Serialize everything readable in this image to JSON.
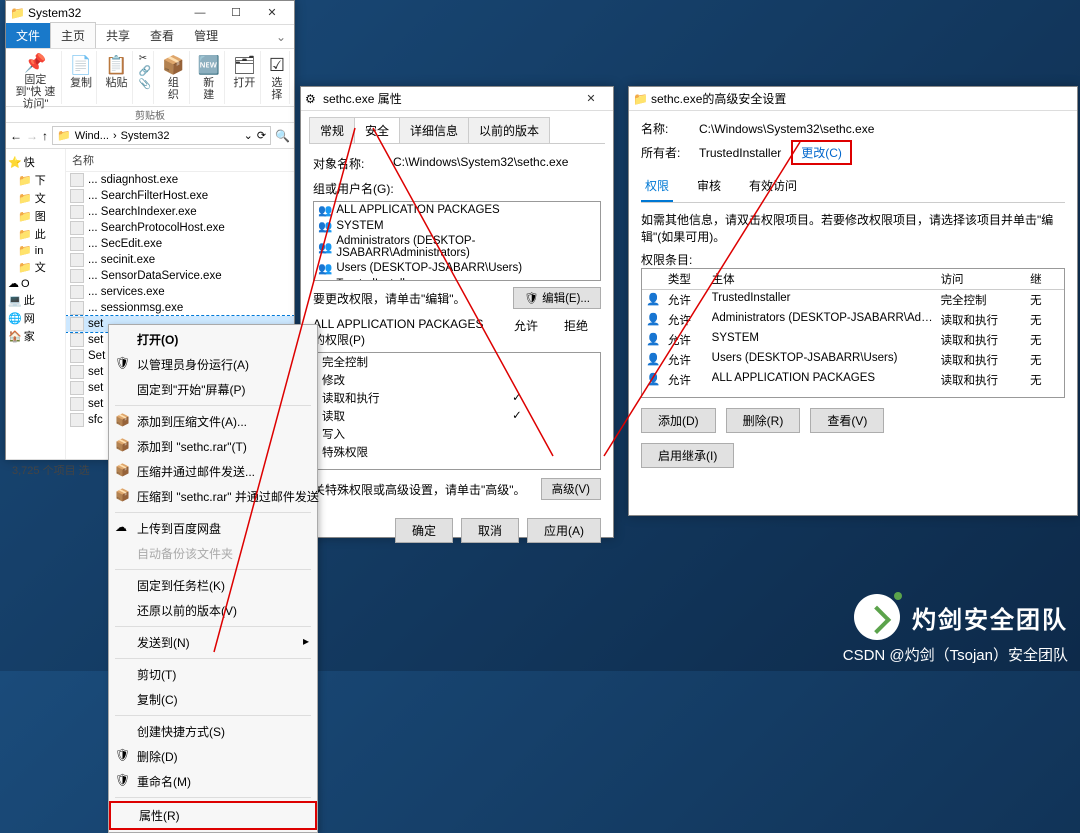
{
  "explorer": {
    "window_title": "System32",
    "ribbon_tabs": {
      "file": "文件",
      "home": "主页",
      "share": "共享",
      "view": "查看",
      "manage": "管理"
    },
    "ribbon": {
      "pin": "固定到\"快\n速访问\"",
      "copy": "复制",
      "paste": "粘贴",
      "clipboard_group": "剪贴板",
      "organize": "组\n织",
      "new": "新\n建",
      "open2": "打开",
      "select": "选择"
    },
    "address": {
      "seg1": "Wind...",
      "seg2": "System32"
    },
    "nav": {
      "quick": "快",
      "items": [
        "下",
        "文",
        "图",
        "此",
        "in",
        "文"
      ],
      "onedrive_label": "O",
      "thispc_label": "此",
      "network_label": "网",
      "home_label": "家"
    },
    "col_name": "名称",
    "files": [
      "sdiagnhost.exe",
      "SearchFilterHost.exe",
      "SearchIndexer.exe",
      "SearchProtocolHost.exe",
      "SecEdit.exe",
      "secinit.exe",
      "SensorDataService.exe",
      "services.exe",
      "sessionmsg.exe"
    ],
    "file_sel": "set",
    "files2": [
      "set",
      "Set",
      "set",
      "set",
      "set",
      "sfc"
    ],
    "prefix": "...",
    "status": "3,725 个项目    选"
  },
  "ctx": {
    "open": "打开(O)",
    "runas": "以管理员身份运行(A)",
    "pin_start": "固定到\"开始\"屏幕(P)",
    "add_archive": "添加到压缩文件(A)...",
    "add_to_rar": "添加到 \"sethc.rar\"(T)",
    "compress_email": "压缩并通过邮件发送...",
    "compress_rar_email": "压缩到 \"sethc.rar\" 并通过邮件发送",
    "upload_baidu": "上传到百度网盘",
    "auto_backup": "自动备份该文件夹",
    "pin_taskbar": "固定到任务栏(K)",
    "restore_prev": "还原以前的版本(V)",
    "send_to": "发送到(N)",
    "cut": "剪切(T)",
    "copy": "复制(C)",
    "create_shortcut": "创建快捷方式(S)",
    "delete": "删除(D)",
    "rename": "重命名(M)",
    "properties": "属性(R)"
  },
  "props": {
    "title": "sethc.exe 属性",
    "tabs": {
      "general": "常规",
      "security": "安全",
      "details": "详细信息",
      "prev": "以前的版本"
    },
    "obj_label": "对象名称:",
    "obj_value": "C:\\Windows\\System32\\sethc.exe",
    "group_label": "组或用户名(G):",
    "groups": [
      "ALL APPLICATION PACKAGES",
      "SYSTEM",
      "Administrators (DESKTOP-JSABARR\\Administrators)",
      "Users (DESKTOP-JSABARR\\Users)",
      "TrustedInstaller"
    ],
    "note_edit": "要更改权限，请单击\"编辑\"。",
    "btn_edit": "编辑(E)...",
    "perm_label": "ALL APPLICATION PACKAGES\n的权限(P)",
    "allow": "允许",
    "deny": "拒绝",
    "perm_names": [
      "完全控制",
      "修改",
      "读取和执行",
      "读取",
      "写入",
      "特殊权限"
    ],
    "note_adv": "关特殊权限或高级设置，请单击\"高级\"。",
    "btn_adv": "高级(V)",
    "btn_ok": "确定",
    "btn_cancel": "取消",
    "btn_apply": "应用(A)"
  },
  "advsec": {
    "title": "sethc.exe的高级安全设置",
    "name_label": "名称:",
    "name_value": "C:\\Windows\\System32\\sethc.exe",
    "owner_label": "所有者:",
    "owner_value": "TrustedInstaller",
    "change": "更改(C)",
    "tabs": {
      "perm": "权限",
      "audit": "审核",
      "effective": "有效访问"
    },
    "hint": "如需其他信息，请双击权限项目。若要修改权限项目，请选择该项目并单击\"编辑\"(如果可用)。",
    "entries_label": "权限条目:",
    "cols": {
      "type": "类型",
      "principal": "主体",
      "access": "访问",
      "inherit": "继"
    },
    "rows": [
      {
        "type": "允许",
        "principal": "TrustedInstaller",
        "access": "完全控制",
        "inh": "无"
      },
      {
        "type": "允许",
        "principal": "Administrators (DESKTOP-JSABARR\\Administrat...",
        "access": "读取和执行",
        "inh": "无"
      },
      {
        "type": "允许",
        "principal": "SYSTEM",
        "access": "读取和执行",
        "inh": "无"
      },
      {
        "type": "允许",
        "principal": "Users (DESKTOP-JSABARR\\Users)",
        "access": "读取和执行",
        "inh": "无"
      },
      {
        "type": "允许",
        "principal": "ALL APPLICATION PACKAGES",
        "access": "读取和执行",
        "inh": "无"
      }
    ],
    "btn_add": "添加(D)",
    "btn_remove": "删除(R)",
    "btn_view": "查看(V)",
    "btn_enable_inh": "启用继承(I)"
  },
  "watermark": {
    "title": "灼剑安全团队",
    "sub": "CSDN @灼剑（Tsojan）安全团队"
  }
}
